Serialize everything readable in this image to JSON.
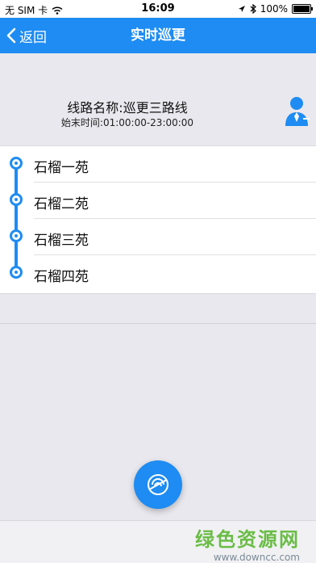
{
  "status_bar": {
    "carrier": "无 SIM 卡",
    "time": "16:09",
    "battery": "100%"
  },
  "nav": {
    "back_label": "返回",
    "title": "实时巡更"
  },
  "route": {
    "name": "线路名称:巡更三路线",
    "time_range": "始末时间:01:00:00-23:00:00"
  },
  "stops": [
    {
      "label": "石榴一苑"
    },
    {
      "label": "石榴二苑"
    },
    {
      "label": "石榴三苑"
    },
    {
      "label": "石榴四苑"
    }
  ],
  "watermark": {
    "main": "绿色资源网",
    "sub": "www.downcc.com"
  },
  "colors": {
    "accent": "#1e8cf2",
    "background": "#e9e8ee"
  }
}
